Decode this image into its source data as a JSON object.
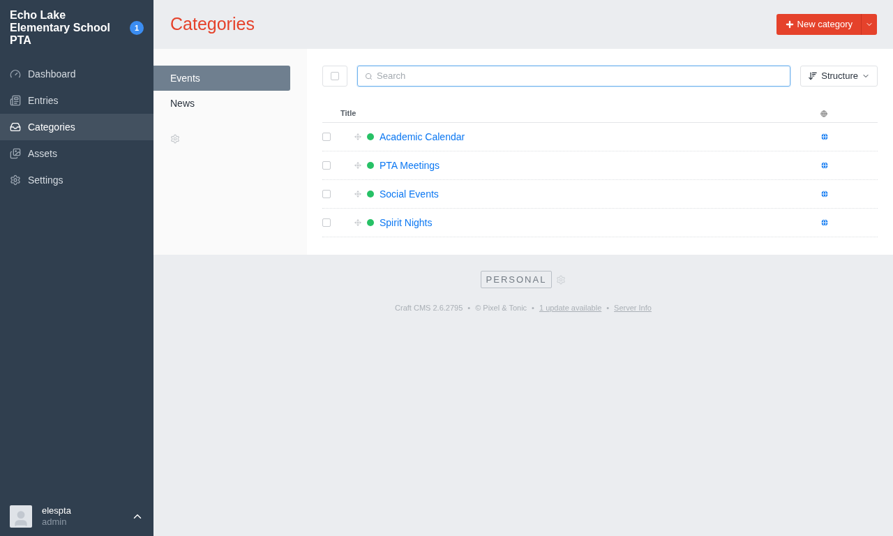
{
  "site": {
    "name": "Echo Lake Elementary School PTA",
    "badge": "1"
  },
  "nav": [
    {
      "label": "Dashboard",
      "selected": false
    },
    {
      "label": "Entries",
      "selected": false
    },
    {
      "label": "Categories",
      "selected": true
    },
    {
      "label": "Assets",
      "selected": false
    },
    {
      "label": "Settings",
      "selected": false
    }
  ],
  "user": {
    "name": "elespta",
    "role": "admin"
  },
  "page": {
    "title": "Categories",
    "new_button": "New category"
  },
  "groups": [
    {
      "label": "Events",
      "selected": true
    },
    {
      "label": "News",
      "selected": false
    }
  ],
  "toolbar": {
    "select_all_checked": false,
    "search_placeholder": "Search",
    "sort_button": "Structure"
  },
  "table": {
    "columns": [
      "Title"
    ],
    "rows": [
      {
        "title": "Academic Calendar",
        "checked": false,
        "color": "#27c166"
      },
      {
        "title": "PTA Meetings",
        "checked": false,
        "color": "#27c166"
      },
      {
        "title": "Social Events",
        "checked": false,
        "color": "#27c166"
      },
      {
        "title": "Spirit Nights",
        "checked": false,
        "color": "#27c166"
      }
    ]
  },
  "footer": {
    "edition": "PERSONAL",
    "version": "Craft CMS 2.6.2795",
    "copyright": "© Pixel & Tonic",
    "update_link": "1 update available",
    "server_link": "Server Info",
    "separator": "•"
  }
}
